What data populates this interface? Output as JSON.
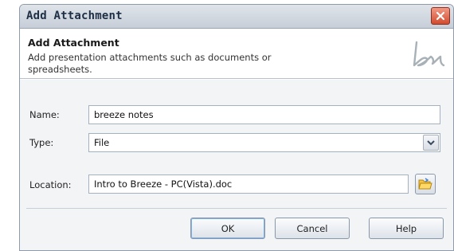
{
  "window": {
    "title": "Add Attachment"
  },
  "header": {
    "title": "Add Attachment",
    "description": "Add presentation attachments such as documents or spreadsheets.",
    "logo_icon": "breeze-logo-icon"
  },
  "form": {
    "name_label": "Name:",
    "name_value": "breeze notes",
    "type_label": "Type:",
    "type_value": "File",
    "location_label": "Location:",
    "location_value": "Intro to Breeze - PC(Vista).doc"
  },
  "buttons": {
    "ok": "OK",
    "cancel": "Cancel",
    "help": "Help"
  },
  "colors": {
    "close_button": "#d24b2e",
    "title_text": "#1f2f45",
    "ok_focus": "#7eb1e6"
  }
}
